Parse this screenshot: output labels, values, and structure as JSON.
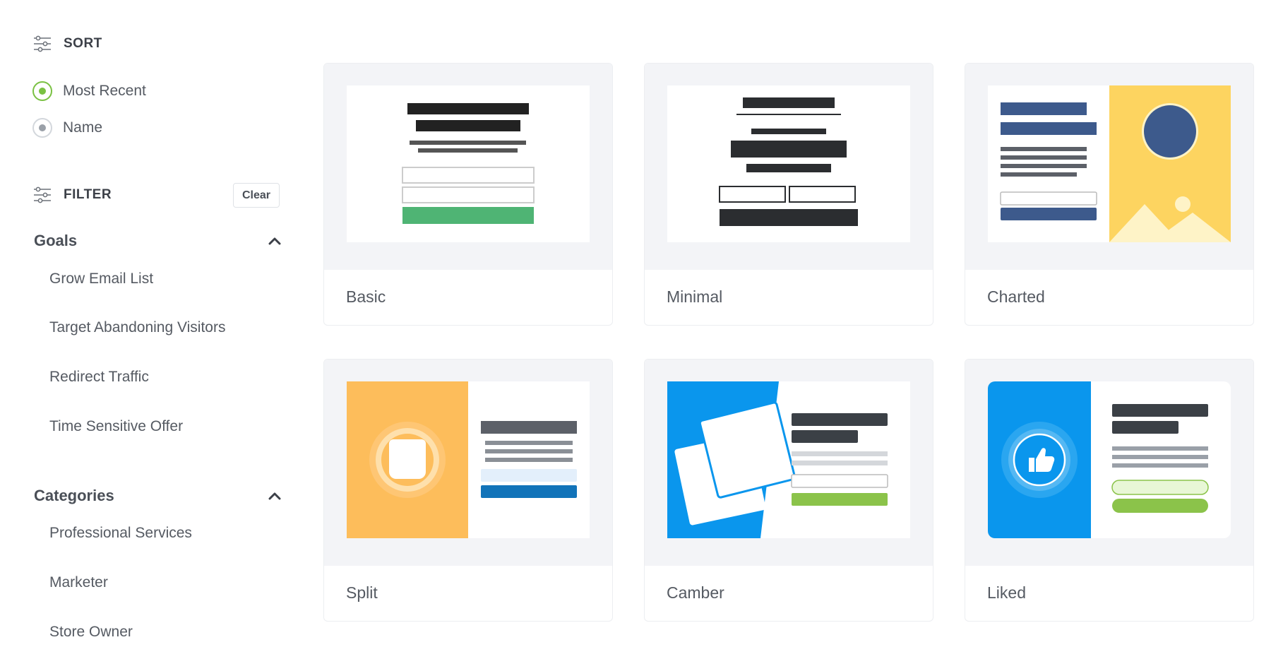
{
  "sort": {
    "title": "SORT",
    "options": [
      {
        "label": "Most Recent",
        "selected": true
      },
      {
        "label": "Name",
        "selected": false
      }
    ]
  },
  "filter": {
    "title": "FILTER",
    "clear_label": "Clear"
  },
  "goals": {
    "title": "Goals",
    "items": [
      "Grow Email List",
      "Target Abandoning Visitors",
      "Redirect Traffic",
      "Time Sensitive Offer"
    ]
  },
  "categories": {
    "title": "Categories",
    "items": [
      "Professional Services",
      "Marketer",
      "Store Owner"
    ]
  },
  "templates": [
    {
      "name": "Basic"
    },
    {
      "name": "Minimal"
    },
    {
      "name": "Charted"
    },
    {
      "name": "Split"
    },
    {
      "name": "Camber"
    },
    {
      "name": "Liked"
    }
  ],
  "colors": {
    "accent_green": "#7ac143",
    "preview_bg": "#f3f4f7"
  }
}
